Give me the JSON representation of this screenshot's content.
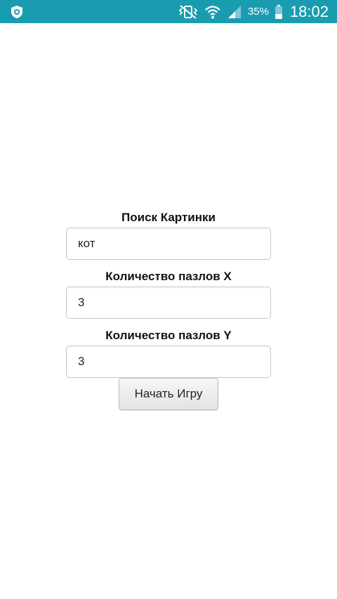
{
  "status_bar": {
    "background_color": "#1a9cb0",
    "left_icon": "app-notification-icon",
    "battery_percent": "35%",
    "time": "18:02",
    "icons": [
      "vibrate-mute-icon",
      "wifi-icon",
      "signal-icon",
      "battery-icon"
    ]
  },
  "form": {
    "search_label": "Поиск Картинки",
    "search_value": "кот",
    "puzzles_x_label": "Количество пазлов X",
    "puzzles_x_value": "3",
    "puzzles_y_label": "Количество пазлов Y",
    "puzzles_y_value": "3",
    "start_button_label": "Начать Игру"
  }
}
